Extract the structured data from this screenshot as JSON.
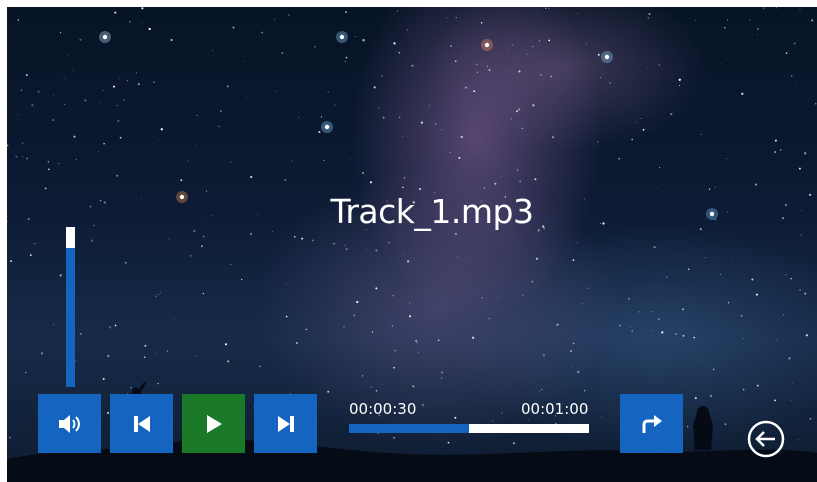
{
  "player": {
    "track_title": "Track_1.mp3",
    "time_current": "00:00:30",
    "time_total": "00:01:00",
    "progress": 0.5,
    "volume": 0.87
  },
  "controls": {
    "volume_icon": "speaker-icon",
    "prev_icon": "skip-previous-icon",
    "play_icon": "play-icon",
    "next_icon": "skip-next-icon",
    "share_icon": "forward-arrow-icon",
    "back_icon": "back-arrow-icon"
  },
  "colors": {
    "button_blue": "#1565c0",
    "play_green": "#1b7a28",
    "text": "#ffffff"
  }
}
